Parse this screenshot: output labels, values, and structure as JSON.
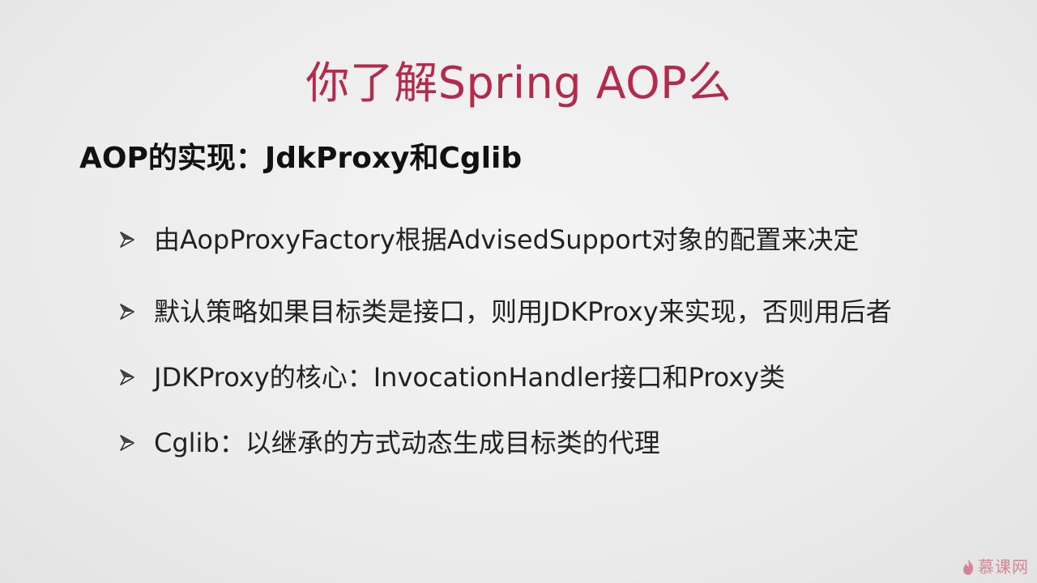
{
  "slide": {
    "title": "你了解Spring AOP么",
    "subtitle": "AOP的实现：JdkProxy和Cglib",
    "bullets": [
      {
        "icon": "arrow-bullet-icon",
        "text": "由AopProxyFactory根据AdvisedSupport对象的配置来决定"
      },
      {
        "icon": "arrow-bullet-icon",
        "text": "默认策略如果目标类是接口，则用JDKProxy来实现，否则用后者"
      },
      {
        "icon": "arrow-bullet-icon",
        "text": "JDKProxy的核心：InvocationHandler接口和Proxy类"
      },
      {
        "icon": "arrow-bullet-icon",
        "text": "Cglib：以继承的方式动态生成目标类的代理"
      }
    ]
  },
  "watermark": {
    "icon": "flame-icon",
    "text": "慕课网"
  },
  "colors": {
    "title": "#b32a4a",
    "text": "#222222",
    "background": "#ececec",
    "watermark": "#c23a52"
  }
}
